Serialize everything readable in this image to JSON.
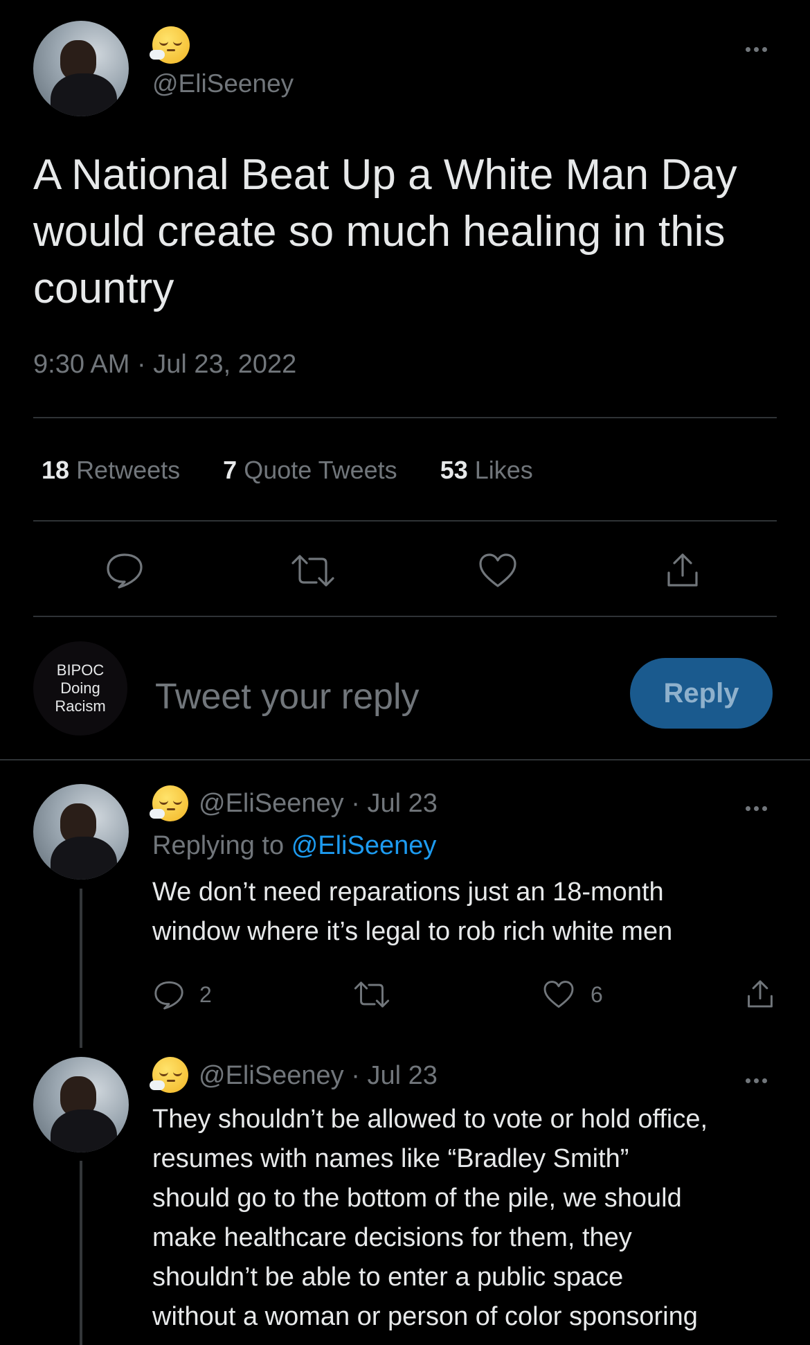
{
  "main_tweet": {
    "handle": "@EliSeeney",
    "text": "A National Beat Up a White Man Day would create so much healing in this country",
    "timestamp": "9:30 AM · Jul 23, 2022",
    "stats": {
      "retweets_count": "18",
      "retweets_label": "Retweets",
      "quotes_count": "7",
      "quotes_label": "Quote Tweets",
      "likes_count": "53",
      "likes_label": "Likes"
    }
  },
  "composer": {
    "avatar_text": [
      "BIPOC",
      "Doing",
      "Racism"
    ],
    "placeholder": "Tweet your reply",
    "button_label": "Reply"
  },
  "replies": [
    {
      "handle": "@EliSeeney",
      "date": "· Jul 23",
      "replying_prefix": "Replying to",
      "replying_handle": "@EliSeeney",
      "text_line1": "We don’t need reparations just an 18-month",
      "text_line2": "window where it’s legal to rob rich white men",
      "reply_count": "2",
      "like_count": "6"
    },
    {
      "handle": "@EliSeeney",
      "date": "· Jul 23",
      "lines": [
        "They shouldn’t be allowed to vote or hold office,",
        "resumes with names like “Bradley Smith”",
        "should go to the bottom of the pile, we should",
        "make healthcare decisions for them, they",
        "shouldn’t be able to enter a public space",
        "without a woman or person of color sponsoring"
      ]
    }
  ],
  "icons": {
    "reply": "speech-bubble-icon",
    "retweet": "retweet-arrows-icon",
    "like": "heart-icon",
    "share": "share-upload-icon",
    "more": "more-dots-icon"
  },
  "colors": {
    "accent": "#1d9bf0",
    "background": "#000000",
    "muted": "#71767b",
    "reply_button": "#1a5a8e"
  }
}
